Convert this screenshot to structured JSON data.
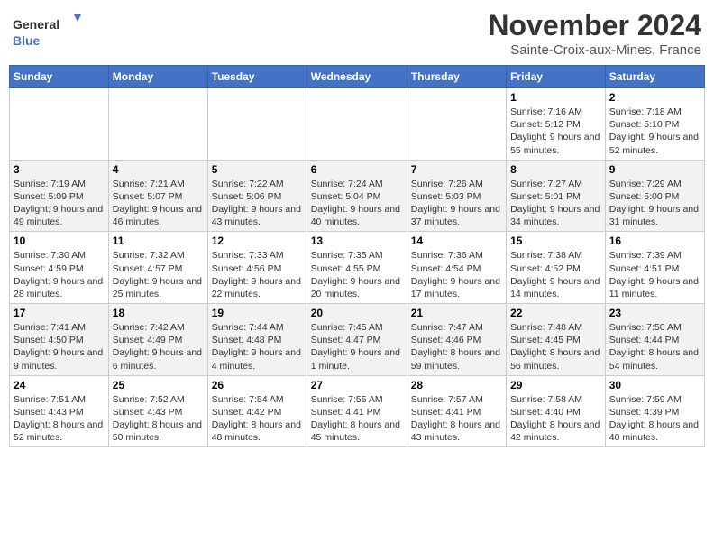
{
  "header": {
    "logo_line1": "General",
    "logo_line2": "Blue",
    "month": "November 2024",
    "location": "Sainte-Croix-aux-Mines, France"
  },
  "days_of_week": [
    "Sunday",
    "Monday",
    "Tuesday",
    "Wednesday",
    "Thursday",
    "Friday",
    "Saturday"
  ],
  "weeks": [
    {
      "days": [
        {
          "date": "",
          "info": ""
        },
        {
          "date": "",
          "info": ""
        },
        {
          "date": "",
          "info": ""
        },
        {
          "date": "",
          "info": ""
        },
        {
          "date": "",
          "info": ""
        },
        {
          "date": "1",
          "info": "Sunrise: 7:16 AM\nSunset: 5:12 PM\nDaylight: 9 hours and 55 minutes."
        },
        {
          "date": "2",
          "info": "Sunrise: 7:18 AM\nSunset: 5:10 PM\nDaylight: 9 hours and 52 minutes."
        }
      ]
    },
    {
      "days": [
        {
          "date": "3",
          "info": "Sunrise: 7:19 AM\nSunset: 5:09 PM\nDaylight: 9 hours and 49 minutes."
        },
        {
          "date": "4",
          "info": "Sunrise: 7:21 AM\nSunset: 5:07 PM\nDaylight: 9 hours and 46 minutes."
        },
        {
          "date": "5",
          "info": "Sunrise: 7:22 AM\nSunset: 5:06 PM\nDaylight: 9 hours and 43 minutes."
        },
        {
          "date": "6",
          "info": "Sunrise: 7:24 AM\nSunset: 5:04 PM\nDaylight: 9 hours and 40 minutes."
        },
        {
          "date": "7",
          "info": "Sunrise: 7:26 AM\nSunset: 5:03 PM\nDaylight: 9 hours and 37 minutes."
        },
        {
          "date": "8",
          "info": "Sunrise: 7:27 AM\nSunset: 5:01 PM\nDaylight: 9 hours and 34 minutes."
        },
        {
          "date": "9",
          "info": "Sunrise: 7:29 AM\nSunset: 5:00 PM\nDaylight: 9 hours and 31 minutes."
        }
      ]
    },
    {
      "days": [
        {
          "date": "10",
          "info": "Sunrise: 7:30 AM\nSunset: 4:59 PM\nDaylight: 9 hours and 28 minutes."
        },
        {
          "date": "11",
          "info": "Sunrise: 7:32 AM\nSunset: 4:57 PM\nDaylight: 9 hours and 25 minutes."
        },
        {
          "date": "12",
          "info": "Sunrise: 7:33 AM\nSunset: 4:56 PM\nDaylight: 9 hours and 22 minutes."
        },
        {
          "date": "13",
          "info": "Sunrise: 7:35 AM\nSunset: 4:55 PM\nDaylight: 9 hours and 20 minutes."
        },
        {
          "date": "14",
          "info": "Sunrise: 7:36 AM\nSunset: 4:54 PM\nDaylight: 9 hours and 17 minutes."
        },
        {
          "date": "15",
          "info": "Sunrise: 7:38 AM\nSunset: 4:52 PM\nDaylight: 9 hours and 14 minutes."
        },
        {
          "date": "16",
          "info": "Sunrise: 7:39 AM\nSunset: 4:51 PM\nDaylight: 9 hours and 11 minutes."
        }
      ]
    },
    {
      "days": [
        {
          "date": "17",
          "info": "Sunrise: 7:41 AM\nSunset: 4:50 PM\nDaylight: 9 hours and 9 minutes."
        },
        {
          "date": "18",
          "info": "Sunrise: 7:42 AM\nSunset: 4:49 PM\nDaylight: 9 hours and 6 minutes."
        },
        {
          "date": "19",
          "info": "Sunrise: 7:44 AM\nSunset: 4:48 PM\nDaylight: 9 hours and 4 minutes."
        },
        {
          "date": "20",
          "info": "Sunrise: 7:45 AM\nSunset: 4:47 PM\nDaylight: 9 hours and 1 minute."
        },
        {
          "date": "21",
          "info": "Sunrise: 7:47 AM\nSunset: 4:46 PM\nDaylight: 8 hours and 59 minutes."
        },
        {
          "date": "22",
          "info": "Sunrise: 7:48 AM\nSunset: 4:45 PM\nDaylight: 8 hours and 56 minutes."
        },
        {
          "date": "23",
          "info": "Sunrise: 7:50 AM\nSunset: 4:44 PM\nDaylight: 8 hours and 54 minutes."
        }
      ]
    },
    {
      "days": [
        {
          "date": "24",
          "info": "Sunrise: 7:51 AM\nSunset: 4:43 PM\nDaylight: 8 hours and 52 minutes."
        },
        {
          "date": "25",
          "info": "Sunrise: 7:52 AM\nSunset: 4:43 PM\nDaylight: 8 hours and 50 minutes."
        },
        {
          "date": "26",
          "info": "Sunrise: 7:54 AM\nSunset: 4:42 PM\nDaylight: 8 hours and 48 minutes."
        },
        {
          "date": "27",
          "info": "Sunrise: 7:55 AM\nSunset: 4:41 PM\nDaylight: 8 hours and 45 minutes."
        },
        {
          "date": "28",
          "info": "Sunrise: 7:57 AM\nSunset: 4:41 PM\nDaylight: 8 hours and 43 minutes."
        },
        {
          "date": "29",
          "info": "Sunrise: 7:58 AM\nSunset: 4:40 PM\nDaylight: 8 hours and 42 minutes."
        },
        {
          "date": "30",
          "info": "Sunrise: 7:59 AM\nSunset: 4:39 PM\nDaylight: 8 hours and 40 minutes."
        }
      ]
    }
  ]
}
